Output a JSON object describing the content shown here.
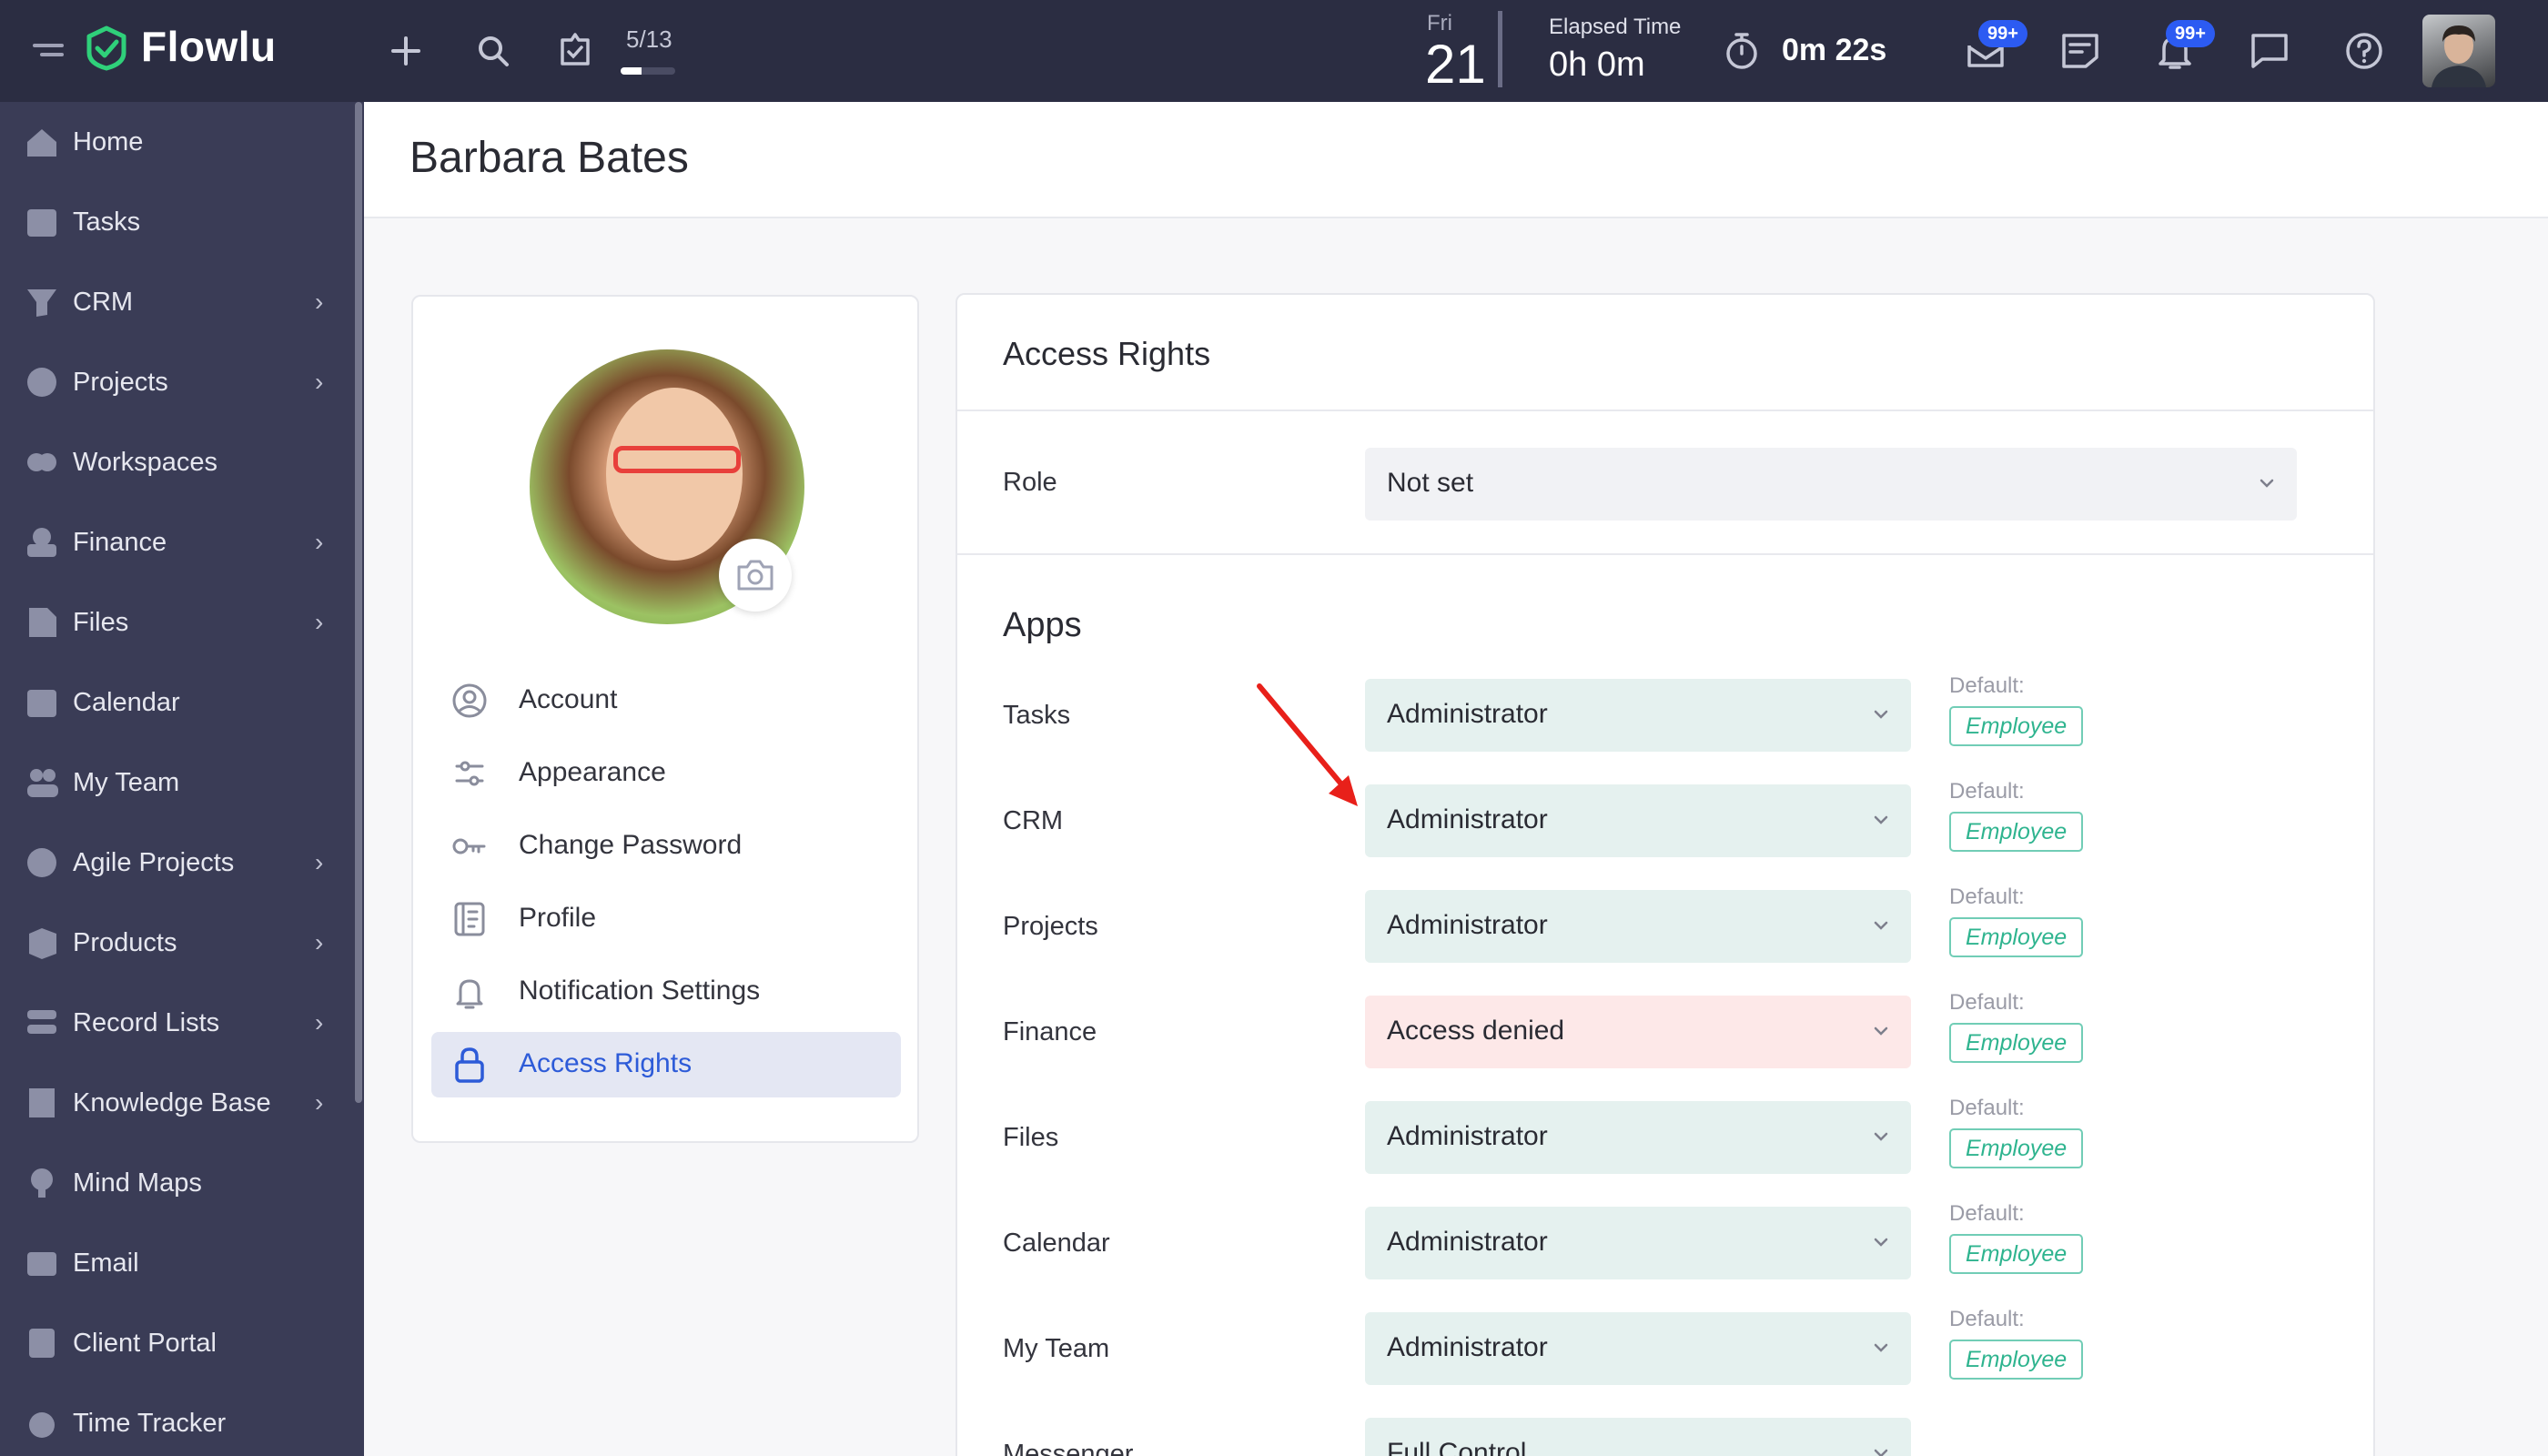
{
  "topbar": {
    "logo": "Flowlu",
    "counter": "5/13",
    "counter_progress": 0.38,
    "date_day": "Fri",
    "date_num": "21",
    "elapsed_label": "Elapsed Time",
    "elapsed_value": "0h 0m",
    "timer_value": "0m 22s",
    "mail_badge": "99+",
    "notif_badge": "99+"
  },
  "sidebar": {
    "items": [
      {
        "label": "Home",
        "icon": "home-icon",
        "chevron": false
      },
      {
        "label": "Tasks",
        "icon": "tasks-icon",
        "chevron": false
      },
      {
        "label": "CRM",
        "icon": "crm-icon",
        "chevron": true
      },
      {
        "label": "Projects",
        "icon": "projects-icon",
        "chevron": true
      },
      {
        "label": "Workspaces",
        "icon": "workspaces-icon",
        "chevron": false
      },
      {
        "label": "Finance",
        "icon": "finance-icon",
        "chevron": true
      },
      {
        "label": "Files",
        "icon": "files-icon",
        "chevron": true
      },
      {
        "label": "Calendar",
        "icon": "calendar-icon",
        "chevron": false
      },
      {
        "label": "My Team",
        "icon": "team-icon",
        "chevron": false
      },
      {
        "label": "Agile Projects",
        "icon": "agile-icon",
        "chevron": true
      },
      {
        "label": "Products",
        "icon": "products-icon",
        "chevron": true
      },
      {
        "label": "Record Lists",
        "icon": "record-lists-icon",
        "chevron": true
      },
      {
        "label": "Knowledge Base",
        "icon": "knowledge-base-icon",
        "chevron": true
      },
      {
        "label": "Mind Maps",
        "icon": "mind-maps-icon",
        "chevron": false
      },
      {
        "label": "Email",
        "icon": "email-icon",
        "chevron": false
      },
      {
        "label": "Client Portal",
        "icon": "client-portal-icon",
        "chevron": false
      },
      {
        "label": "Time Tracker",
        "icon": "time-tracker-icon",
        "chevron": false
      }
    ]
  },
  "page": {
    "title": "Barbara Bates"
  },
  "profile_menu": {
    "items": [
      {
        "label": "Account",
        "icon": "account-icon",
        "active": false
      },
      {
        "label": "Appearance",
        "icon": "appearance-icon",
        "active": false
      },
      {
        "label": "Change Password",
        "icon": "key-icon",
        "active": false
      },
      {
        "label": "Profile",
        "icon": "profile-icon",
        "active": false
      },
      {
        "label": "Notification Settings",
        "icon": "bell-icon",
        "active": false
      },
      {
        "label": "Access Rights",
        "icon": "lock-icon",
        "active": true
      }
    ]
  },
  "access": {
    "title": "Access Rights",
    "role_label": "Role",
    "role_value": "Not set",
    "apps_title": "Apps",
    "default_label": "Default:",
    "apps": [
      {
        "label": "Tasks",
        "value": "Administrator",
        "default": "Employee",
        "state": "normal"
      },
      {
        "label": "CRM",
        "value": "Administrator",
        "default": "Employee",
        "state": "normal"
      },
      {
        "label": "Projects",
        "value": "Administrator",
        "default": "Employee",
        "state": "normal"
      },
      {
        "label": "Finance",
        "value": "Access denied",
        "default": "Employee",
        "state": "denied"
      },
      {
        "label": "Files",
        "value": "Administrator",
        "default": "Employee",
        "state": "normal"
      },
      {
        "label": "Calendar",
        "value": "Administrator",
        "default": "Employee",
        "state": "normal"
      },
      {
        "label": "My Team",
        "value": "Administrator",
        "default": "Employee",
        "state": "normal"
      },
      {
        "label": "Messenger",
        "value": "Full Control",
        "default": "",
        "state": "normal"
      }
    ]
  },
  "colors": {
    "topbar": "#2b2d42",
    "sidebar": "#3a3c56",
    "accent": "#2d5bd8",
    "select_bg": "#e5f1ef",
    "denied_bg": "#fde8e8",
    "tag": "#2fb48f",
    "arrow": "#e8201a"
  }
}
